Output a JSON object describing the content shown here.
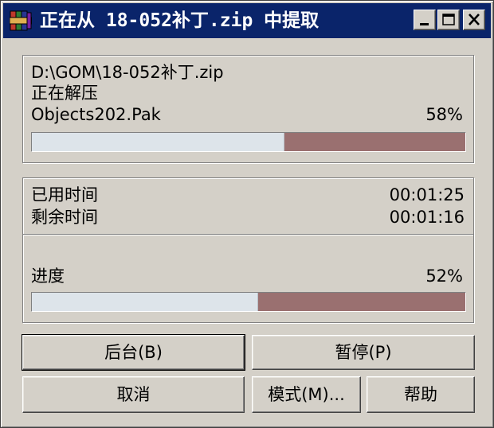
{
  "window": {
    "title": "正在从 18-052补丁.zip 中提取"
  },
  "file_panel": {
    "archive_path": "D:\\GOM\\18-052补丁.zip",
    "status": "正在解压",
    "current_file": "Objects202.Pak",
    "file_percent_label": "58%",
    "file_progress_percent": 58
  },
  "time_panel": {
    "elapsed_label": "已用时间",
    "elapsed_value": "00:01:25",
    "remaining_label": "剩余时间",
    "remaining_value": "00:01:16",
    "progress_label": "进度",
    "total_percent_label": "52%",
    "total_progress_percent": 52
  },
  "buttons": {
    "background": "后台(B)",
    "pause": "暂停(P)",
    "cancel": "取消",
    "mode": "模式(M)...",
    "help": "帮助"
  },
  "colors": {
    "titlebar": "#0a246a",
    "progress_fill": "#dde4ea",
    "progress_remaining": "#9a7070"
  },
  "icons": {
    "app": "winrar-books-icon",
    "minimize": "minimize-icon",
    "maximize": "maximize-icon",
    "close": "close-icon"
  }
}
